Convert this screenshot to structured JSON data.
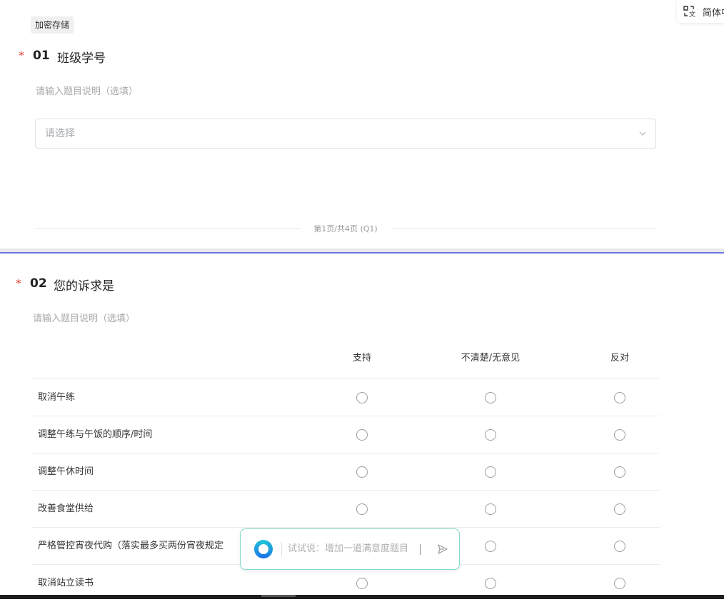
{
  "header": {
    "language_label": "简体中",
    "language_icon": "translate-icon",
    "tag": "加密存储"
  },
  "q1": {
    "required_mark": "*",
    "number": "01",
    "title": "班级学号",
    "description": "请输入题目说明（选填）",
    "select_placeholder": "请选择",
    "select_icon": "chevron-down-icon"
  },
  "pager": {
    "text": "第1页/共4页 (Q1)"
  },
  "q2": {
    "required_mark": "*",
    "number": "02",
    "title": "您的诉求是",
    "description": "请输入题目说明（选填）",
    "columns": [
      "支持",
      "不清楚/无意见",
      "反对"
    ],
    "rows": [
      {
        "label": "取消午练"
      },
      {
        "label": "调整午练与午饭的顺序/时间"
      },
      {
        "label": "调整午休时间"
      },
      {
        "label": "改善食堂供给"
      },
      {
        "label": "严格管控宵夜代购（落实最多买两份宵夜规定"
      },
      {
        "label": "取消站立读书"
      }
    ]
  },
  "ai_input": {
    "placeholder": "试试说：增加一道满意度题目",
    "send_icon": "send-icon",
    "logo_icon": "ai-assistant-logo-icon"
  },
  "colors": {
    "required": "#e5483c",
    "accent_line": "#6b72e8",
    "ai_border": "#7fd8c8"
  }
}
